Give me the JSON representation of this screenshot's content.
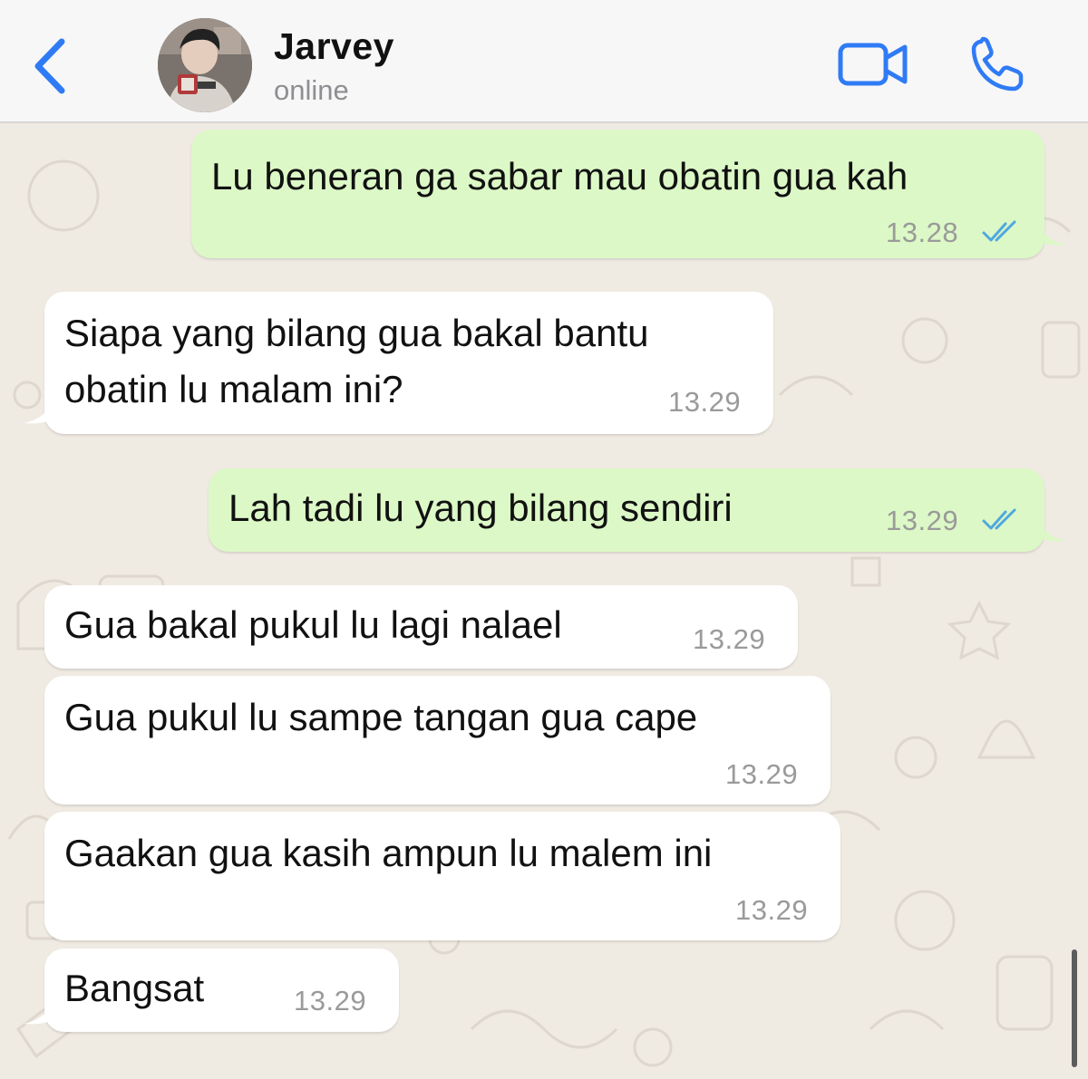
{
  "header": {
    "contact_name": "Jarvey",
    "status": "online"
  },
  "messages": [
    {
      "direction": "outgoing",
      "lines": [
        "Lu beneran ga sabar mau obatin gua kah"
      ],
      "time": "13.28",
      "read": true
    },
    {
      "direction": "incoming",
      "lines": [
        "Siapa yang bilang gua bakal bantu",
        "obatin lu malam ini?"
      ],
      "time": "13.29"
    },
    {
      "direction": "outgoing",
      "lines": [
        "Lah tadi lu yang bilang sendiri"
      ],
      "time": "13.29",
      "read": true
    },
    {
      "direction": "incoming",
      "lines": [
        "Gua bakal pukul lu lagi nalael"
      ],
      "time": "13.29"
    },
    {
      "direction": "incoming",
      "lines": [
        "Gua pukul lu sampe tangan gua cape"
      ],
      "time": "13.29"
    },
    {
      "direction": "incoming",
      "lines": [
        "Gaakan gua kasih ampun lu malem ini"
      ],
      "time": "13.29"
    },
    {
      "direction": "incoming",
      "lines": [
        "Bangsat"
      ],
      "time": "13.29"
    }
  ],
  "colors": {
    "accent": "#2f7bf5",
    "outgoing_bubble": "#dcf8c6",
    "incoming_bubble": "#ffffff",
    "read_ticks": "#4fa8e0",
    "wallpaper": "#efeae2"
  },
  "icons": {
    "back": "chevron-left-icon",
    "video": "video-camera-icon",
    "call": "phone-icon",
    "read_receipt": "double-check-icon"
  }
}
